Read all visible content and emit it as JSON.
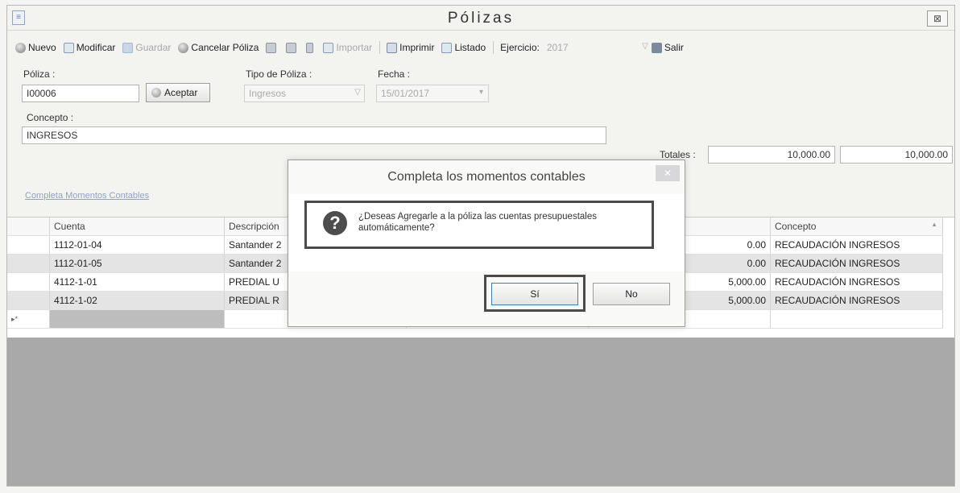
{
  "window": {
    "title": "Pólizas",
    "close_glyph": "⊠"
  },
  "toolbar": {
    "nuevo": "Nuevo",
    "modificar": "Modificar",
    "guardar": "Guardar",
    "cancelar": "Cancelar Póliza",
    "importar": "Importar",
    "imprimir": "Imprimir",
    "listado": "Listado",
    "ejercicio_label": "Ejercicio:",
    "ejercicio_value": "2017",
    "salir": "Salir"
  },
  "form": {
    "poliza_label": "Póliza :",
    "poliza_value": "I00006",
    "aceptar": "Aceptar",
    "tipo_label": "Tipo de Póliza :",
    "tipo_value": "Ingresos",
    "fecha_label": "Fecha :",
    "fecha_value": "15/01/2017",
    "concepto_label": "Concepto :",
    "concepto_value": "INGRESOS",
    "totales_label": "Totales :",
    "total_cargo": "10,000.00",
    "total_abono": "10,000.00",
    "link": "Completa Momentos Contables"
  },
  "grid": {
    "headers": {
      "cuenta": "Cuenta",
      "descripcion": "Descripción",
      "concepto": "Concepto",
      "sort_glyph": "▲"
    },
    "rows": [
      {
        "cuenta": "1112-01-04",
        "descripcion": "Santander 2",
        "importe": "0.00",
        "concepto": "RECAUDACIÓN INGRESOS"
      },
      {
        "cuenta": "1112-01-05",
        "descripcion": "Santander 2",
        "importe": "0.00",
        "concepto": "RECAUDACIÓN INGRESOS"
      },
      {
        "cuenta": "4112-1-01",
        "descripcion": "PREDIAL U",
        "importe": "5,000.00",
        "concepto": "RECAUDACIÓN INGRESOS"
      },
      {
        "cuenta": "4112-1-02",
        "descripcion": "PREDIAL R",
        "importe": "5,000.00",
        "concepto": "RECAUDACIÓN INGRESOS"
      }
    ],
    "new_row_marker": "▸*"
  },
  "dialog": {
    "title": "Completa los momentos contables",
    "message": "¿Deseas Agregarle a la póliza las cuentas presupuestales automáticamente?",
    "icon_glyph": "?",
    "close_glyph": "✕",
    "yes": "Sí",
    "no": "No"
  }
}
